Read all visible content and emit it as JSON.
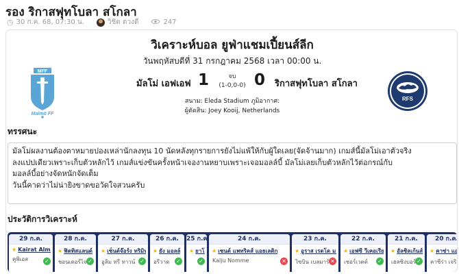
{
  "page": {
    "title": "รอง ริกาสฟุทโบลา สโกลา",
    "date": "30 ก.ค. 68, 07:30 น.",
    "author": "วิชิต ดวงดี",
    "views": "247"
  },
  "match": {
    "title": "วิเคราะห์บอล ยูฟ่าแชมเปี้ยนส์ลีก",
    "date_line": "วันพฤหัสบดีที่ 31 กรกฎาคม 2568 เวลา 00:00 น.",
    "home_team": "มัลโม่ เอฟเอฟ",
    "away_team": "ริกาสฟุทโบลา สโกลา",
    "home_score": "1",
    "away_score": "0",
    "status": "จบ",
    "half_time": "(1-0,0-0)",
    "venue": "สนาม: Eleda Stadium ภูมิอากาศ:",
    "referee": "ผู้ตัดสิน: Joey Kooij, Netherlands",
    "home_logo_text": "MFF",
    "home_logo_caption": "Malmö FF",
    "away_logo_text": "RFS"
  },
  "opinion": {
    "heading": "ทรรศนะ",
    "lines": [
      "มัลโม่ผลงานต้องตาหมายปองเหล่านักลงทุน 10 นัดหลังทุกรายการยังไม่แพ้ให้กับผู้ใดเลย(จัดจ้านมาก) เกมส์นี้มัลโม่เอาตัวจริง",
      "ลงแปปเดียวเพราะเก็บตัวหลักไว้ เกมส์แข่งขันครั้งหน้าเจองานหยาบเพราะเจอมอลล์บี้ มัลโม่เลยเก็บตัวหลักไว้ต่อกรณ์กับ",
      "มอลล์บี้อย่างจัดหนักจัดเต็ม",
      "วันนี้คาดว่าไม่น่ายิงขาดขอวัดใจสวนครับ"
    ]
  },
  "history": {
    "heading": "ประวัติการวิเคราะห์",
    "items": [
      {
        "date": "29 ก.ค.",
        "team1": "Kairat Almaty",
        "team2": "คูพิเอส",
        "result": "win"
      },
      {
        "date": "28 ก.ค.",
        "team1": "ฟิตทิสแลนด์",
        "team2": "ชอนเดอร์ไจสกี",
        "result": "win"
      },
      {
        "date": "27 ก.ค.",
        "team1": "เซ็นต์จ๊อร์ง ทริมิท",
        "team2": "อูลิม ทรี ทาวน์",
        "result": "win"
      },
      {
        "date": "26 ก.ค.",
        "team1": "ยัง มอลล์",
        "team2": "อรีวาด",
        "result": "win"
      },
      {
        "date": "25 ก.ค.",
        "team1": "ยาโร",
        "team2": "",
        "result": "win"
      },
      {
        "date": "24 ก.ค.",
        "team1": "เซนต์ แพทริคส์ แอธเลติก",
        "team2": "Kalju Nomme",
        "result": "lose"
      },
      {
        "date": "23 ก.ค.",
        "team1": "อูราส เรดโด มอนส์",
        "team2": "ไซบิน เบลมาร์",
        "result": "lose"
      },
      {
        "date": "22 ก.ค.",
        "team1": "เอฟซี วีเคอเรีย พิลเซ่น",
        "team2": "เซอร์เวตต์",
        "result": "win"
      },
      {
        "date": "21 ก.ค.",
        "team1": "อัลซิลเก้นส์ บิเค",
        "team2": "เฮลซิงบอร์ก",
        "result": "win"
      },
      {
        "date": "20 ก.ค.",
        "team1": "คาซ่า แอนท์ เลอร์ส",
        "team2": "คาซีร่า เจริกอร์",
        "result": "lose"
      }
    ]
  },
  "colors": {
    "history_bg": "#1e2f63",
    "win": "#3fb950",
    "lose": "#e5484d",
    "home_logo": "#5aa5d6",
    "away_logo": "#1e3a6e"
  }
}
